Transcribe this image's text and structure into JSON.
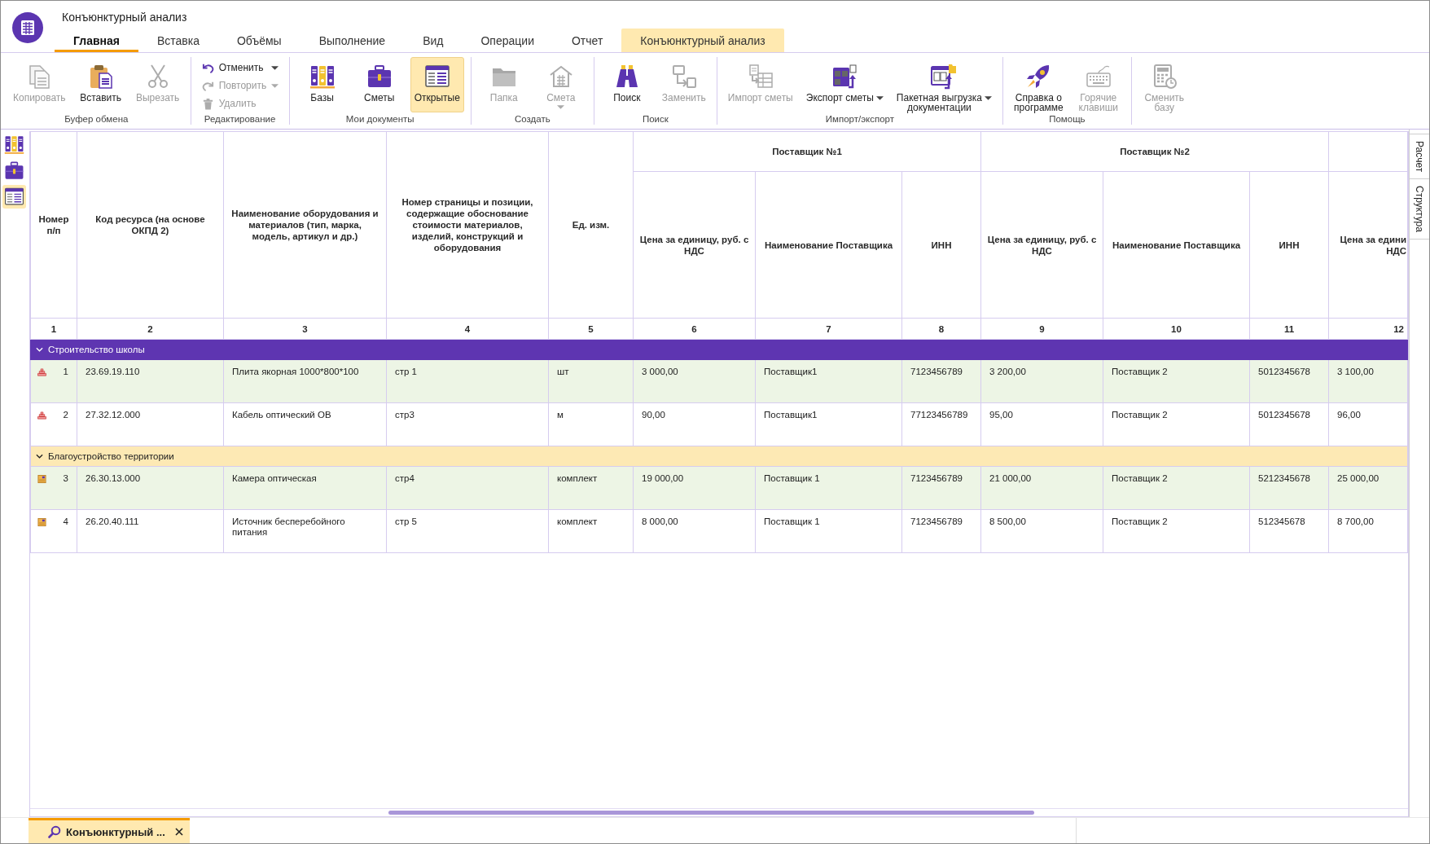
{
  "app": {
    "title": "Конъюнктурный анализ"
  },
  "tabs": [
    {
      "label": "Главная",
      "selected": true,
      "contextual": false
    },
    {
      "label": "Вставка",
      "selected": false,
      "contextual": false
    },
    {
      "label": "Объёмы",
      "selected": false,
      "contextual": false
    },
    {
      "label": "Выполнение",
      "selected": false,
      "contextual": false
    },
    {
      "label": "Вид",
      "selected": false,
      "contextual": false
    },
    {
      "label": "Операции",
      "selected": false,
      "contextual": false
    },
    {
      "label": "Отчет",
      "selected": false,
      "contextual": false
    },
    {
      "label": "Конъюнктурный анализ",
      "selected": false,
      "contextual": true
    }
  ],
  "ribbon": [
    {
      "label": "Буфер обмена",
      "kind": "large",
      "buttons": [
        {
          "label": "Копировать",
          "kind": "copy",
          "disabled": true,
          "selected": false,
          "dropdown": false
        },
        {
          "label": "Вставить",
          "kind": "paste",
          "disabled": false,
          "selected": false,
          "dropdown": false
        },
        {
          "label": "Вырезать",
          "kind": "cut",
          "disabled": true,
          "selected": false,
          "dropdown": false
        }
      ]
    },
    {
      "label": "Редактирование",
      "kind": "small",
      "buttons": [
        {
          "label": "Отменить",
          "kind": "undo",
          "disabled": false,
          "selected": false,
          "dropdown": true,
          "split": false
        },
        {
          "label": "Повторить",
          "kind": "redo",
          "disabled": true,
          "selected": false,
          "dropdown": true,
          "split": false
        },
        {
          "label": "Удалить",
          "kind": "delete",
          "disabled": true,
          "selected": false,
          "dropdown": false
        }
      ]
    },
    {
      "label": "Мои документы",
      "kind": "large",
      "buttons": [
        {
          "label": "Базы",
          "kind": "bases",
          "disabled": false,
          "selected": false,
          "dropdown": false
        },
        {
          "label": "Сметы",
          "kind": "estimates",
          "disabled": false,
          "selected": false,
          "dropdown": false
        },
        {
          "label": "Открытые",
          "kind": "open",
          "disabled": false,
          "selected": true,
          "dropdown": false
        }
      ]
    },
    {
      "label": "Создать",
      "kind": "large",
      "buttons": [
        {
          "label": "Папка",
          "kind": "folder",
          "disabled": true,
          "selected": false,
          "dropdown": false
        },
        {
          "label": "Смета",
          "kind": "estimate",
          "disabled": true,
          "selected": false,
          "dropdown": true,
          "split": true
        }
      ]
    },
    {
      "label": "Поиск",
      "kind": "large",
      "buttons": [
        {
          "label": "Поиск",
          "kind": "search",
          "disabled": false,
          "selected": false,
          "dropdown": false
        },
        {
          "label": "Заменить",
          "kind": "replace",
          "disabled": true,
          "selected": false,
          "dropdown": false
        }
      ]
    },
    {
      "label": "Импорт/экспорт",
      "kind": "large",
      "buttons": [
        {
          "label": "Импорт сметы",
          "kind": "import",
          "disabled": true,
          "selected": false,
          "dropdown": false
        },
        {
          "label": "Экспорт сметы",
          "kind": "export",
          "disabled": false,
          "selected": false,
          "dropdown": true,
          "split": false
        },
        {
          "label": "Пакетная выгрузка\nдокументации",
          "kind": "batch",
          "disabled": false,
          "selected": false,
          "dropdown": true,
          "split": false
        }
      ]
    },
    {
      "label": "Помощь",
      "kind": "large",
      "buttons": [
        {
          "label": "Справка о\nпрограмме",
          "kind": "help",
          "disabled": false,
          "selected": false,
          "dropdown": false
        },
        {
          "label": "Горячие\nклавиши",
          "kind": "hotkeys",
          "disabled": true,
          "selected": false,
          "dropdown": false
        }
      ]
    },
    {
      "kind": "large",
      "buttons": [
        {
          "label": "Сменить\nбазу",
          "kind": "switch",
          "disabled": true,
          "selected": false,
          "dropdown": false
        }
      ]
    }
  ],
  "sidebar": [
    {
      "kind": "bases",
      "selected": false
    },
    {
      "kind": "estimates",
      "selected": false
    },
    {
      "kind": "open",
      "selected": true
    }
  ],
  "side_tabs": [
    {
      "label": "Расчет",
      "selected": false
    },
    {
      "label": "Структура",
      "selected": false
    }
  ],
  "table": {
    "columns": [
      {
        "label": "Номер п/п",
        "number": "1"
      },
      {
        "label": "Код ресурса (на основе ОКПД 2)",
        "number": "2"
      },
      {
        "label": "Наименование оборудования и материалов (тип, марка, модель, артикул и др.)",
        "number": "3"
      },
      {
        "label": "Номер страницы и позиции, содержащие обоснование стоимости материалов, изделий, конструкций и оборудования",
        "number": "4"
      },
      {
        "label": "Ед. изм.",
        "number": "5"
      }
    ],
    "suppliers": [
      {
        "label": "Поставщик №1",
        "columns": [
          {
            "label": "Цена за единицу, руб. с НДС",
            "number": "6"
          },
          {
            "label": "Наименование Поставщика",
            "number": "7"
          },
          {
            "label": "ИНН",
            "number": "8"
          }
        ]
      },
      {
        "label": "Поставщик №2",
        "columns": [
          {
            "label": "Цена за единицу, руб. с НДС",
            "number": "9"
          },
          {
            "label": "Наименование Поставщика",
            "number": "10"
          },
          {
            "label": "ИНН",
            "number": "11"
          }
        ]
      },
      {
        "columns": [
          {
            "label": "Цена за едини\nНДС",
            "number": "12"
          }
        ]
      }
    ],
    "groups": [
      {
        "name": "Строительство школы",
        "expanded": true,
        "selected": true,
        "rows": [
          {
            "kind": "material",
            "highlighted": true,
            "cells": [
              "1",
              "23.69.19.110",
              "Плита якорная 1000*800*100",
              "стр 1",
              "шт",
              "3 000,00",
              "Поставщик1",
              "7123456789",
              "3 200,00",
              "Поставщик 2",
              "5012345678",
              "3 100,00"
            ]
          },
          {
            "kind": "material",
            "highlighted": false,
            "cells": [
              "2",
              "27.32.12.000",
              "Кабель оптический ОВ",
              "стр3",
              "м",
              "90,00",
              "Поставщик1",
              "77123456789",
              "95,00",
              "Поставщик 2",
              "5012345678",
              "96,00"
            ]
          }
        ]
      },
      {
        "name": "Благоустройство территории",
        "expanded": true,
        "selected": false,
        "rows": [
          {
            "kind": "equipment",
            "highlighted": true,
            "cells": [
              "3",
              "26.30.13.000",
              "Камера оптическая",
              "стр4",
              "комплект",
              "19 000,00",
              "Поставщик 1",
              "7123456789",
              "21 000,00",
              "Поставщик 2",
              "5212345678",
              "25 000,00"
            ]
          },
          {
            "kind": "equipment",
            "highlighted": false,
            "cells": [
              "4",
              "26.20.40.111",
              "Источник бесперебойного питания",
              "стр 5",
              "комплект",
              "8 000,00",
              "Поставщик 1",
              "7123456789",
              "8 500,00",
              "Поставщик 2",
              "512345678",
              "8 700,00"
            ]
          }
        ]
      }
    ]
  },
  "document_tabs": [
    {
      "label": "Конъюнктурный ...",
      "selected": true
    }
  ]
}
